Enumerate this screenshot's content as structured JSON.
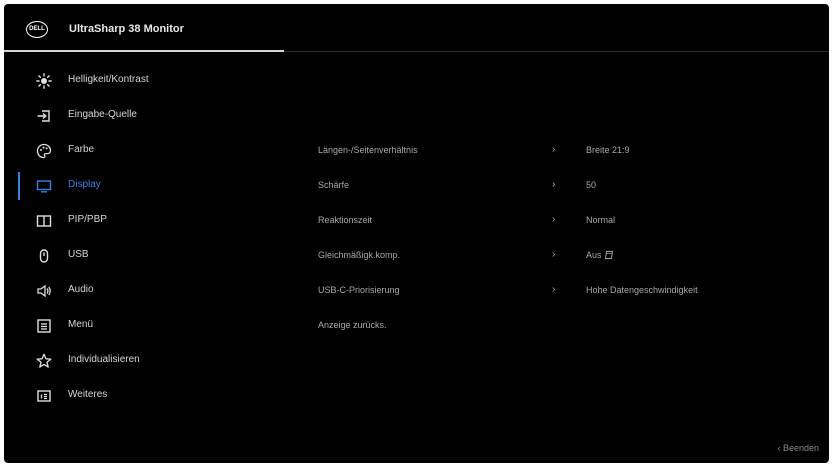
{
  "header": {
    "logo_text": "DELL",
    "title": "UltraSharp 38 Monitor"
  },
  "sidebar": {
    "items": [
      {
        "label": "Helligkeit/Kontrast",
        "icon": "brightness-icon"
      },
      {
        "label": "Eingabe-Quelle",
        "icon": "input-source-icon"
      },
      {
        "label": "Farbe",
        "icon": "palette-icon"
      },
      {
        "label": "Display",
        "icon": "display-icon",
        "active": true
      },
      {
        "label": "PIP/PBP",
        "icon": "pip-pbp-icon"
      },
      {
        "label": "USB",
        "icon": "usb-icon"
      },
      {
        "label": "Audio",
        "icon": "speaker-icon"
      },
      {
        "label": "Menü",
        "icon": "menu-icon"
      },
      {
        "label": "Individualisieren",
        "icon": "star-icon"
      },
      {
        "label": "Weiteres",
        "icon": "info-icon"
      }
    ]
  },
  "settings": [
    {
      "label": "Längen-/Seitenverhältnis",
      "value": "Breite 21:9"
    },
    {
      "label": "Schärfe",
      "value": "50"
    },
    {
      "label": "Reaktionszeit",
      "value": "Normal"
    },
    {
      "label": "Gleichmäßigk.komp.",
      "value": "Aus"
    },
    {
      "label": "USB-C-Priorisierung",
      "value": "Hohe Datengeschwindigkeit"
    },
    {
      "label": "Anzeige zurücks.",
      "value": ""
    }
  ],
  "footer": {
    "exit_label": "‹ Beenden"
  },
  "colors": {
    "background": "#000000",
    "accent": "#3b7fe0",
    "text": "#d8d8d8",
    "muted_text": "#a8a8a8"
  }
}
